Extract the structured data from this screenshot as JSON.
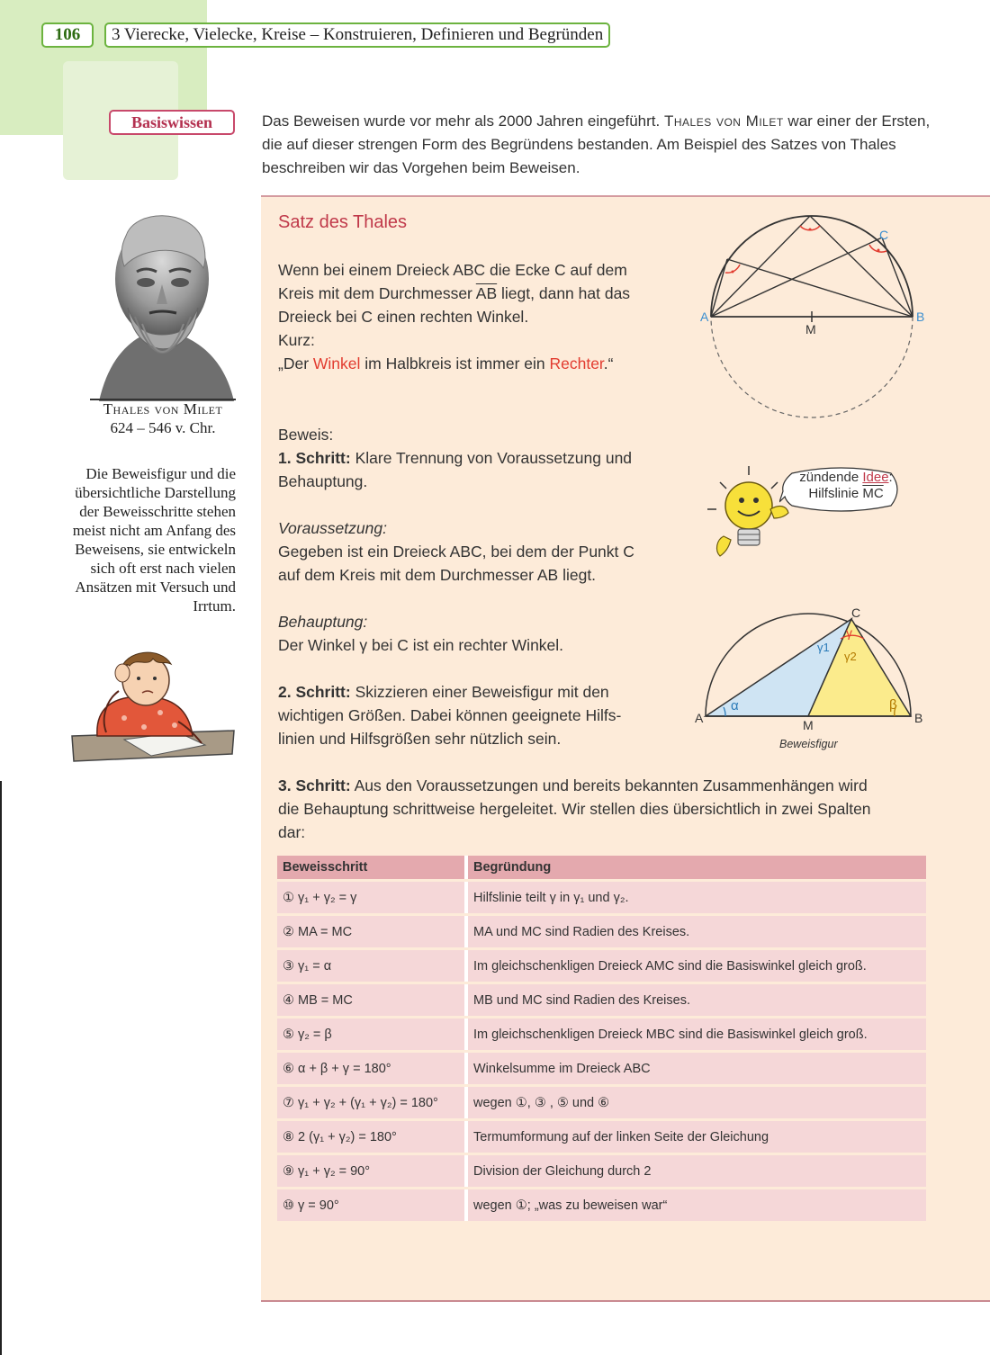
{
  "header": {
    "page_number": "106",
    "chapter_title": "3 Vierecke, Vielecke, Kreise – Konstruieren, Definieren und Begründen"
  },
  "badge": "Basiswissen",
  "intro": {
    "part1": "Das Beweisen wurde vor mehr als 2000 Jahren eingeführt.",
    "name": "Thales von Milet",
    "part2": "war einer der Ersten, die auf dieser strengen Form des Begründens bestanden. Am Beispiel des Satzes von Thales beschreiben wir das Vorgehen beim Beweisen."
  },
  "sidebar": {
    "portrait_name": "Thales von Milet",
    "portrait_years": "624 – 546 v. Chr.",
    "note": "Die Beweisfigur und die übersichtliche Darstellung der Beweisschritte stehen meist nicht am Anfang des Beweisens, sie entwickeln sich oft erst nach vielen Ansätzen mit Versuch und Irrtum."
  },
  "theorem": {
    "title": "Satz des Thales",
    "line1": "Wenn bei einem Dreieck ABC die Ecke C auf dem",
    "line2a": "Kreis mit dem Durchmesser",
    "ab": "AB",
    "line2b": "liegt, dann hat das",
    "line3": "Dreieck bei C einen rechten Winkel.",
    "kurz": "Kurz:",
    "quote_a": "„Der",
    "winkel": "Winkel",
    "quote_b": "im Halbkreis ist immer ein",
    "rechter": "Rechter",
    "quote_c": ".“"
  },
  "figure1": {
    "A": "A",
    "B": "B",
    "C": "C",
    "M": "M"
  },
  "idea": {
    "word1": "zündende",
    "word2": "Idee",
    "colon": ":",
    "hint_a": "Hilfslinie",
    "hint_b": "MC"
  },
  "proof": {
    "beweis": "Beweis:",
    "step1_label": "1. Schritt:",
    "step1_line1": "Klare Trennung von Voraussetzung und",
    "step1_line2": "Behauptung.",
    "vor_label": "Voraussetzung:",
    "vor_line1": "Gegeben ist ein Dreieck ABC, bei dem der Punkt C",
    "vor_line2": "auf dem Kreis mit dem Durchmesser AB liegt.",
    "beh_label": "Behauptung:",
    "beh_text": "Der Winkel γ bei C ist ein rechter Winkel.",
    "step2_label": "2. Schritt:",
    "step2_line1": "Skizzieren einer Beweisfigur mit den",
    "step2_line2": "wichtigen Größen. Dabei können geeignete Hilfs-",
    "step2_line3": "linien und Hilfsgrößen sehr nützlich sein.",
    "step3_label": "3. Schritt:",
    "step3_line1": "Aus den Voraussetzungen und bereits bekannten Zusammenhängen wird",
    "step3_line2": "die Behauptung schrittweise hergeleitet. Wir stellen dies übersichtlich in zwei Spalten",
    "step3_line3": "dar:"
  },
  "figure2": {
    "A": "A",
    "B": "B",
    "C": "C",
    "M": "M",
    "alpha": "α",
    "beta": "β",
    "gamma": "γ",
    "gamma1": "γ1",
    "gamma2": "γ2",
    "caption": "Beweisfigur"
  },
  "table": {
    "headers": [
      "Beweisschritt",
      "Begründung"
    ],
    "rows": [
      {
        "step": "① γ₁ + γ₂ = γ",
        "reason": "Hilfslinie teilt γ in γ₁ und γ₂."
      },
      {
        "step": "② MA = MC",
        "reason": "MA und MC sind Radien des Kreises."
      },
      {
        "step": "③ γ₁ = α",
        "reason": "Im gleichschenkligen Dreieck AMC sind die Basiswinkel gleich groß."
      },
      {
        "step": "④ MB = MC",
        "reason": "MB und MC sind Radien des Kreises."
      },
      {
        "step": "⑤ γ₂ = β",
        "reason": "Im gleichschenkligen Dreieck MBC sind die Basiswinkel gleich groß."
      },
      {
        "step": "⑥ α + β + γ = 180°",
        "reason": "Winkelsumme im Dreieck ABC"
      },
      {
        "step": "⑦ γ₁ + γ₂ + (γ₁ + γ₂) = 180°",
        "reason": "wegen ①, ③ , ⑤ und ⑥"
      },
      {
        "step": "⑧ 2 (γ₁ + γ₂) = 180°",
        "reason": "Termumformung auf der linken Seite der Gleichung"
      },
      {
        "step": "⑨ γ₁ + γ₂ = 90°",
        "reason": "Division der Gleichung durch 2"
      },
      {
        "step": "⑩ γ = 90°",
        "reason": "wegen ①; „was zu beweisen war“"
      }
    ]
  },
  "colors": {
    "accent_red": "#e23b2f",
    "green": "#6cb33f",
    "panel": "#fdebd9",
    "table_cell": "#f5d7d8",
    "table_head": "#e4a9ae",
    "blue_triangle": "#cfe4f3",
    "yellow_triangle": "#fbeb8c"
  }
}
